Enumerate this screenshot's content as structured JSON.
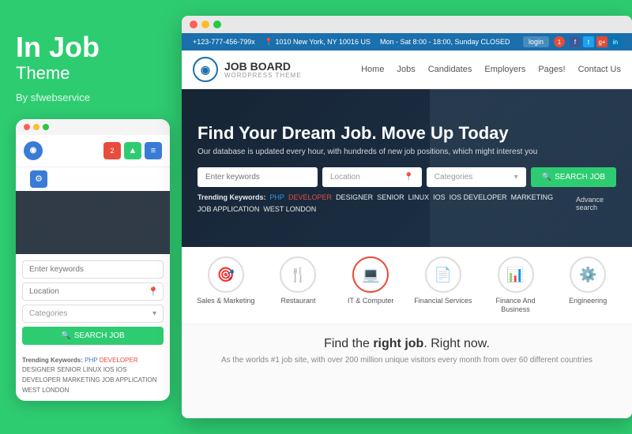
{
  "brand": {
    "title": "In Job",
    "subtitle": "Theme",
    "author": "By sfwebservice"
  },
  "topbar": {
    "phone": "+123-777-456-799x",
    "address": "1010 New York, NY 10016 US",
    "hours": "Mon - Sat 8:00 - 18:00, Sunday CLOSED",
    "login": "login",
    "notification_count": "1"
  },
  "nav": {
    "logo_text": "JOB BOARD",
    "logo_sub": "WORDPRESS THEME",
    "links": [
      "Home",
      "Jobs",
      "Candidates",
      "Employers",
      "Pages!",
      "Contact Us"
    ]
  },
  "hero": {
    "title": "Find Your Dream Job. Move Up Today",
    "subtitle": "Our database is updated every hour, with hundreds of new job positions, which might interest you",
    "search_keywords_placeholder": "Enter keywords",
    "search_location_placeholder": "Location",
    "search_categories_placeholder": "Categories",
    "search_button": "SEARCH JOB",
    "advance_search": "Advance search",
    "trending_label": "Trending Keywords:",
    "keywords": [
      "PHP",
      "DEVELOPER",
      "DESIGNER",
      "SENIOR",
      "LINUX",
      "IOS",
      "IOS DEVELOPER",
      "MARKETING",
      "JOB APPLICATION",
      "WEST LONDON"
    ]
  },
  "categories": [
    {
      "label": "Sales & Marketing",
      "icon": "🎯",
      "active": false
    },
    {
      "label": "Restaurant",
      "icon": "🍴",
      "active": false
    },
    {
      "label": "IT & Computer",
      "icon": "💻",
      "active": true
    },
    {
      "label": "Financial Services",
      "icon": "📄",
      "active": false
    },
    {
      "label": "Finance And Business",
      "icon": "📊",
      "active": false
    },
    {
      "label": "Engineering",
      "icon": "⚙️",
      "active": false
    }
  ],
  "bottom": {
    "title_start": "Find the ",
    "title_bold": "right job",
    "title_end": ". Right now.",
    "subtitle": "As the worlds #1 job site, with over 200 million unique visitors every month from over 60 different countries"
  },
  "mobile": {
    "keywords_placeholder": "Enter keywords",
    "location_placeholder": "Location",
    "categories_placeholder": "Categories",
    "search_button": "SEARCH JOB",
    "trending_label": "Trending Keywords:",
    "keywords_text": "PHP  DEVELOPER  DESIGNER  SENIOR  LINUX  IOS  IOS DEVELOPER  MARKETING  JOB APPLICATION  WEST LONDON"
  }
}
